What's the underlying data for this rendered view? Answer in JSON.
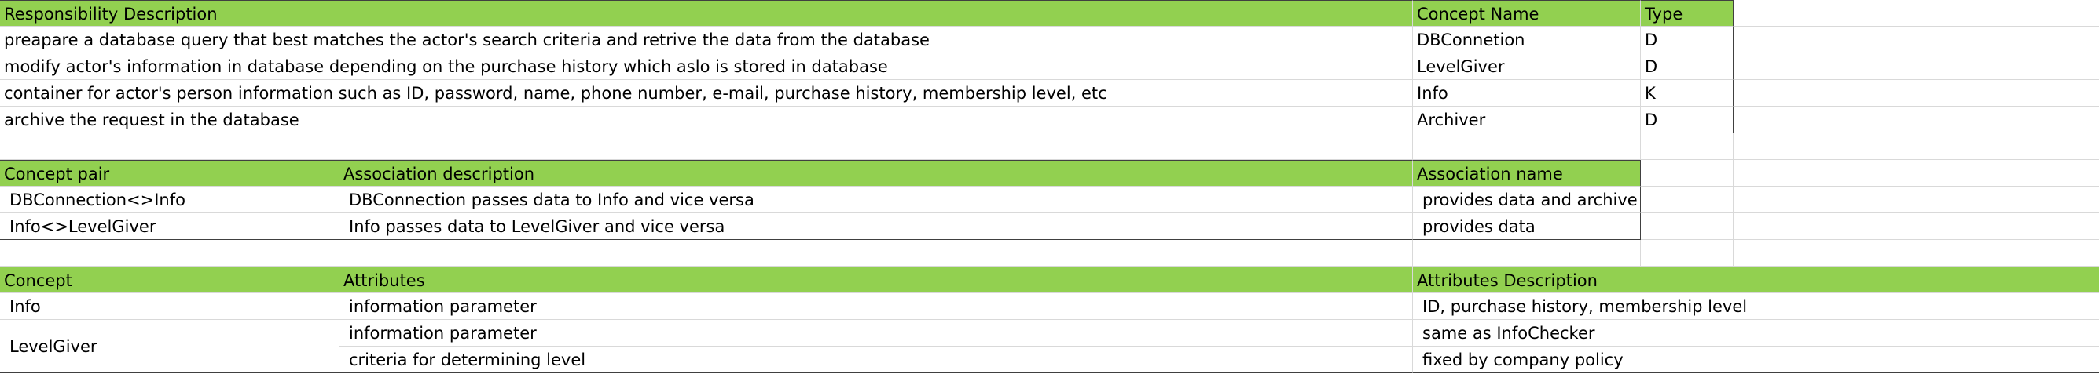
{
  "table1": {
    "headers": [
      "Responsibility Description",
      "Concept Name",
      "Type"
    ],
    "rows": [
      [
        "preapare a database query that best matches the actor's search criteria and retrive the data from the database",
        "DBConnetion",
        "D"
      ],
      [
        "modify actor's information in database depending on the purchase history which aslo is stored in database",
        "LevelGiver",
        "D"
      ],
      [
        "container for actor's person information such as ID, password, name, phone number, e-mail, purchase history, membership level, etc",
        "Info",
        "K"
      ],
      [
        "archive the request in the database",
        "Archiver",
        "D"
      ]
    ]
  },
  "table2": {
    "headers": [
      "Concept pair",
      "Association description",
      "Association name"
    ],
    "rows": [
      [
        "DBConnection<>Info",
        "DBConnection passes data to Info and vice versa",
        "provides data and archive"
      ],
      [
        "Info<>LevelGiver",
        "Info passes data to LevelGiver and vice versa",
        "provides data"
      ]
    ]
  },
  "table3": {
    "headers": [
      "Concept",
      "Attributes",
      "Attributes Description"
    ],
    "rows": [
      {
        "concept": "Info",
        "attribute": "information parameter",
        "description": "ID, purchase history, membership level"
      },
      {
        "concept": "LevelGiver",
        "attribute": "information parameter",
        "description": "same as InfoChecker"
      },
      {
        "concept": "",
        "attribute": "criteria for determining level",
        "description": "fixed by company policy"
      }
    ]
  },
  "colors": {
    "header_fill": "#92d050",
    "gridline": "#d9d9d9",
    "table_border": "#404040"
  }
}
